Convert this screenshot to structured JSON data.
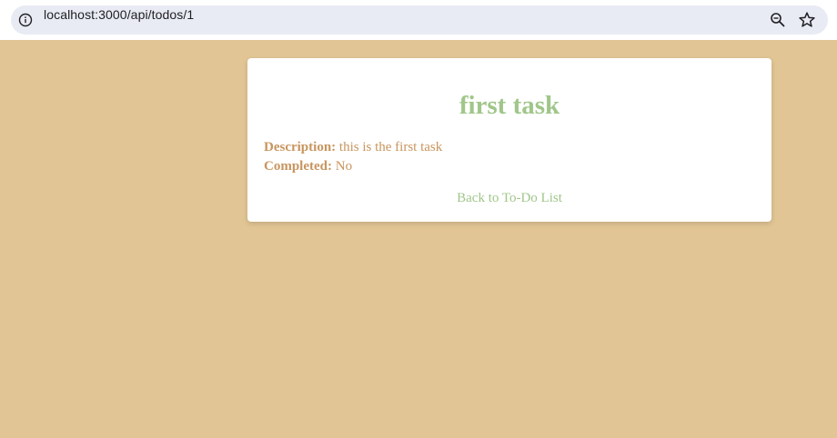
{
  "browser": {
    "url": "localhost:3000/api/todos/1",
    "icons": [
      "info-icon",
      "zoom-icon",
      "star-icon"
    ]
  },
  "todo": {
    "title": "first task",
    "description_label": "Description:",
    "description": "this is the first task",
    "completed_label": "Completed:",
    "completed": "No",
    "back_link": "Back to To-Do List"
  },
  "colors": {
    "page_background": "#e1c594",
    "title_and_link": "#a0c68a",
    "detail_text": "#c8955e",
    "omnibox": "#e8ebf3"
  }
}
